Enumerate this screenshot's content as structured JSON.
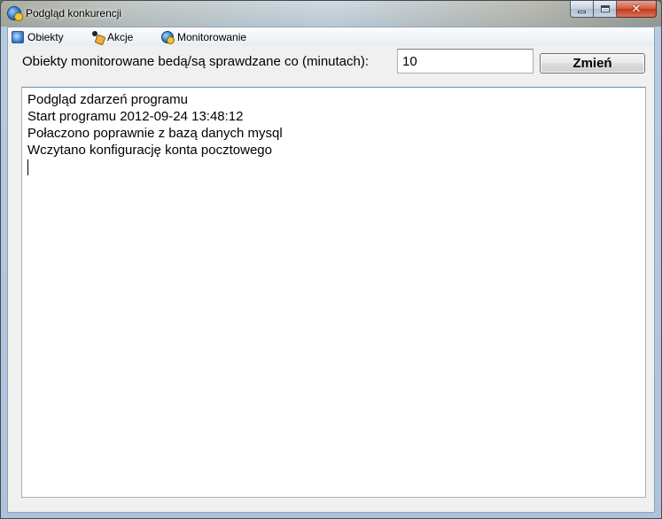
{
  "window": {
    "title": "Podgląd konkurencji"
  },
  "menu": {
    "items": [
      {
        "label": "Obiekty",
        "icon": "objects-icon"
      },
      {
        "label": "Akcje",
        "icon": "actions-icon"
      },
      {
        "label": "Monitorowanie",
        "icon": "monitoring-icon"
      }
    ]
  },
  "interval": {
    "label": "Obiekty monitorowane bedą/są sprawdzane co (minutach):",
    "value": "10",
    "button_label": "Zmień"
  },
  "log": {
    "lines": [
      "Podgląd zdarzeń programu",
      "Start programu 2012-09-24 13:48:12",
      "Połaczono poprawnie z bazą danych mysql",
      "Wczytano konfigurację konta pocztowego"
    ]
  },
  "colors": {
    "close_button": "#c23a1f",
    "window_frame": "#b7cbe0",
    "client_background": "#f0f0f0"
  }
}
